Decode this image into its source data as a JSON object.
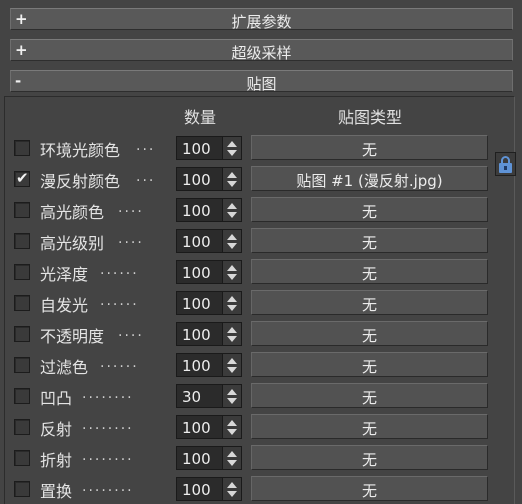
{
  "rollouts": [
    {
      "sign": "+",
      "title": "扩展参数"
    },
    {
      "sign": "+",
      "title": "超级采样"
    },
    {
      "sign": "-",
      "title": "贴图"
    }
  ],
  "headers": {
    "amount": "数量",
    "map_type": "贴图类型"
  },
  "rows": [
    {
      "checked": false,
      "label": "环境光颜色",
      "dots": "...",
      "value": "100",
      "map": "无"
    },
    {
      "checked": true,
      "label": "漫反射颜色",
      "dots": "...",
      "value": "100",
      "map": "贴图 #1 (漫反射.jpg)"
    },
    {
      "checked": false,
      "label": "高光颜色",
      "dots": "....",
      "value": "100",
      "map": "无"
    },
    {
      "checked": false,
      "label": "高光级别",
      "dots": "....",
      "value": "100",
      "map": "无"
    },
    {
      "checked": false,
      "label": "光泽度",
      "dots": "......",
      "value": "100",
      "map": "无"
    },
    {
      "checked": false,
      "label": "自发光",
      "dots": "......",
      "value": "100",
      "map": "无"
    },
    {
      "checked": false,
      "label": "不透明度",
      "dots": "....",
      "value": "100",
      "map": "无"
    },
    {
      "checked": false,
      "label": "过滤色",
      "dots": "......",
      "value": "100",
      "map": "无"
    },
    {
      "checked": false,
      "label": "凹凸",
      "dots": "........",
      "value": "30",
      "map": "无"
    },
    {
      "checked": false,
      "label": "反射",
      "dots": "........",
      "value": "100",
      "map": "无"
    },
    {
      "checked": false,
      "label": "折射",
      "dots": "........",
      "value": "100",
      "map": "无"
    },
    {
      "checked": false,
      "label": "置换",
      "dots": "........",
      "value": "100",
      "map": "无"
    }
  ],
  "icons": {
    "lock": "lock-icon",
    "spinner_up": "spinner-up-icon",
    "spinner_down": "spinner-down-icon",
    "checkmark": "checkmark-icon"
  }
}
